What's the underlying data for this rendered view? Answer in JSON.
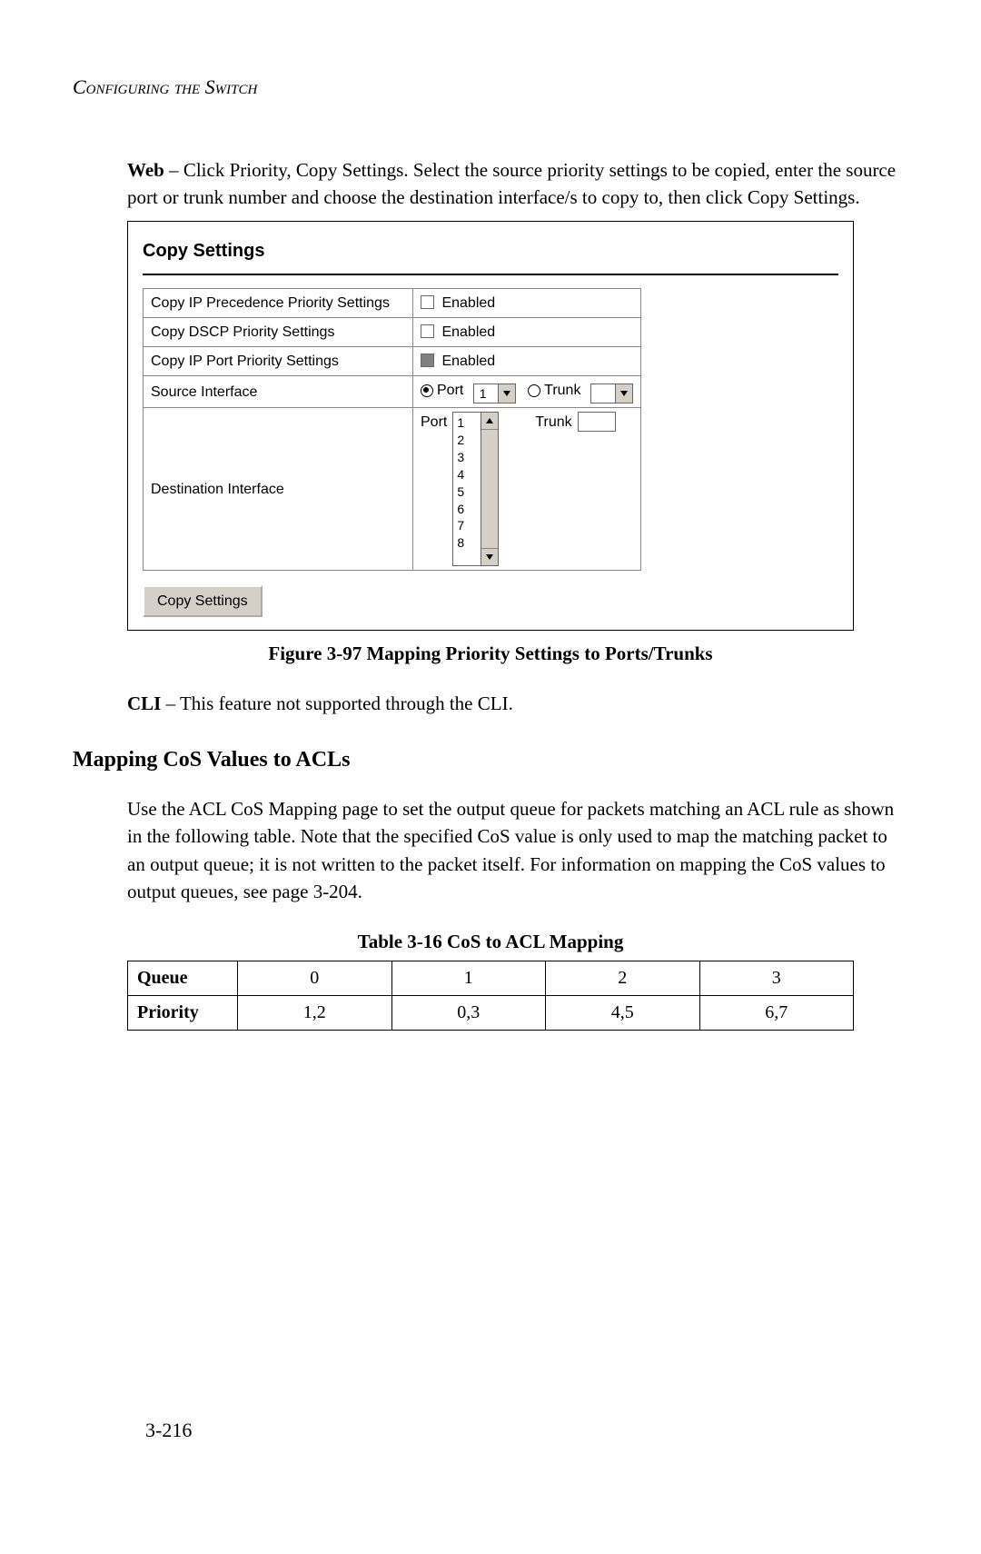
{
  "running_head": "Configuring the Switch",
  "intro": {
    "lead": "Web",
    "text": " – Click Priority, Copy Settings. Select the source priority settings to be copied, enter the source port or trunk number and choose the destination interface/s to copy to, then click Copy Settings."
  },
  "screenshot": {
    "title": "Copy Settings",
    "rows": {
      "ip_prec": {
        "label": "Copy IP Precedence Priority Settings",
        "checkbox_label": "Enabled"
      },
      "dscp": {
        "label": "Copy DSCP Priority Settings",
        "checkbox_label": "Enabled"
      },
      "ip_port": {
        "label": "Copy IP Port Priority Settings",
        "checkbox_label": "Enabled"
      },
      "source": {
        "label": "Source Interface",
        "port_radio": "Port",
        "port_value": "1",
        "trunk_radio": "Trunk",
        "trunk_value": ""
      },
      "dest": {
        "label": "Destination Interface",
        "port_label": "Port",
        "port_items": [
          "1",
          "2",
          "3",
          "4",
          "5",
          "6",
          "7",
          "8"
        ],
        "trunk_label": "Trunk"
      }
    },
    "button": "Copy Settings"
  },
  "figure_caption": "Figure 3-97  Mapping Priority Settings to Ports/Trunks",
  "cli": {
    "lead": "CLI",
    "text": " – This feature not supported through the CLI."
  },
  "section_head": "Mapping CoS Values to ACLs",
  "section_body": "Use the ACL CoS Mapping page to set the output queue for packets matching an ACL rule as shown in the following table. Note that the specified CoS value is only used to map the matching packet to an output queue; it is not written to the packet itself. For information on mapping the CoS values to output queues, see page 3-204.",
  "table_caption": "Table 3-16  CoS to ACL Mapping",
  "cos_table": {
    "headers": [
      "Queue",
      "Priority"
    ],
    "queue": [
      "0",
      "1",
      "2",
      "3"
    ],
    "priority": [
      "1,2",
      "0,3",
      "4,5",
      "6,7"
    ]
  },
  "page_number": "3-216",
  "chart_data": {
    "type": "table",
    "title": "CoS to ACL Mapping",
    "columns": [
      "Queue",
      "Priority"
    ],
    "rows": [
      [
        "0",
        "1,2"
      ],
      [
        "1",
        "0,3"
      ],
      [
        "2",
        "4,5"
      ],
      [
        "3",
        "6,7"
      ]
    ]
  }
}
